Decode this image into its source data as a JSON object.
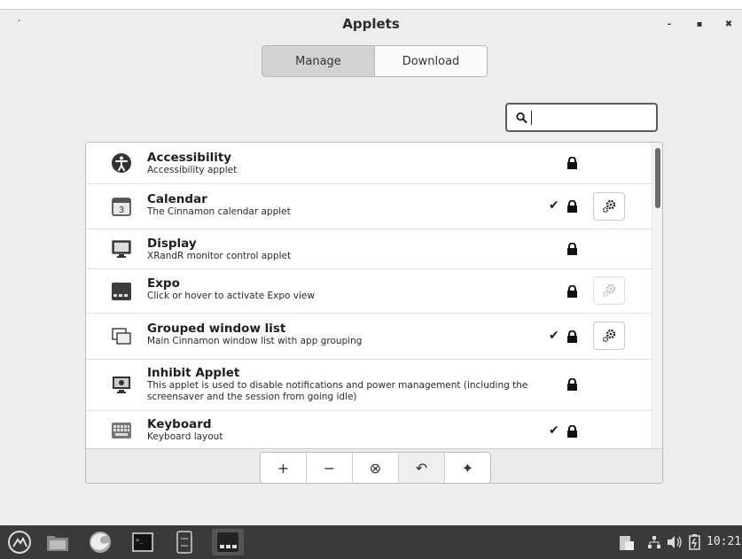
{
  "window": {
    "title": "Applets",
    "app_icon": "cinnamon-applet-icon",
    "minimize_label": "-",
    "maximize_label": "▪",
    "close_label": "✖"
  },
  "tabs": [
    {
      "label": "Manage",
      "active": true
    },
    {
      "label": "Download",
      "active": false
    }
  ],
  "search": {
    "value": "",
    "placeholder": "",
    "icon": "search-icon"
  },
  "applets": [
    {
      "title": "Accessibility",
      "description": "Accessibility applet",
      "enabled": false,
      "locked": true,
      "config": "none",
      "icon": "accessibility-icon"
    },
    {
      "title": "Calendar",
      "description": "The Cinnamon calendar applet",
      "enabled": true,
      "locked": true,
      "config": "enabled",
      "icon": "calendar-icon"
    },
    {
      "title": "Display",
      "description": "XRandR monitor control applet",
      "enabled": false,
      "locked": true,
      "config": "none",
      "icon": "display-icon"
    },
    {
      "title": "Expo",
      "description": "Click or hover to activate Expo view",
      "enabled": false,
      "locked": true,
      "config": "disabled",
      "icon": "expo-icon"
    },
    {
      "title": "Grouped window list",
      "description": "Main Cinnamon window list with app grouping",
      "enabled": true,
      "locked": true,
      "config": "enabled",
      "icon": "window-list-icon"
    },
    {
      "title": "Inhibit Applet",
      "description": "This applet is used to disable notifications and power management (including the screensaver and the session from going idle)",
      "enabled": false,
      "locked": true,
      "config": "none",
      "icon": "inhibit-icon"
    },
    {
      "title": "Keyboard",
      "description": "Keyboard layout",
      "enabled": true,
      "locked": true,
      "config": "none",
      "icon": "keyboard-icon"
    }
  ],
  "toolbar": [
    {
      "label": "+",
      "name": "add-button"
    },
    {
      "label": "−",
      "name": "remove-button"
    },
    {
      "label": "⊗",
      "name": "uninstall-button"
    },
    {
      "label": "↶",
      "name": "restore-button"
    },
    {
      "label": "✦",
      "name": "more-button"
    }
  ],
  "taskbar": {
    "clock": "10:21",
    "items": [
      "menu-icon",
      "files-icon",
      "firefox-icon",
      "terminal-icon",
      "text-editor-icon",
      "applets-window-icon"
    ]
  },
  "colors": {
    "accent": "#5a5a5a",
    "taskbar": "#3a3a3a",
    "list_bg": "#ffffff"
  }
}
